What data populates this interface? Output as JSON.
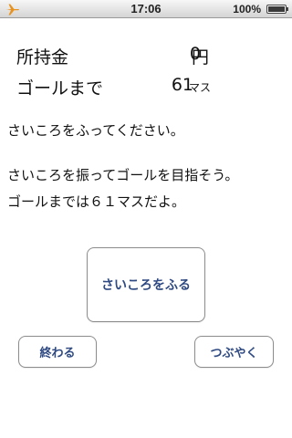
{
  "status_bar": {
    "time": "17:06",
    "battery_text": "100%",
    "battery_level": 1.0,
    "icons": [
      "airplane-mode-icon",
      "battery-icon"
    ]
  },
  "stats": {
    "money_label": "所持金",
    "money_value": "0",
    "money_unit": "円",
    "goal_label": "ゴールまで",
    "goal_value": "61",
    "goal_unit": "マス"
  },
  "messages": {
    "line1": "さいころをふってください。",
    "line2": "さいころを振ってゴールを目指そう。",
    "line3": "ゴールまでは６１マスだよ。"
  },
  "buttons": {
    "roll": "さいころをふる",
    "quit": "終わる",
    "tweet": "つぶやく"
  },
  "colors": {
    "button_text": "#2f4a82",
    "airplane_icon": "#e8921e"
  }
}
